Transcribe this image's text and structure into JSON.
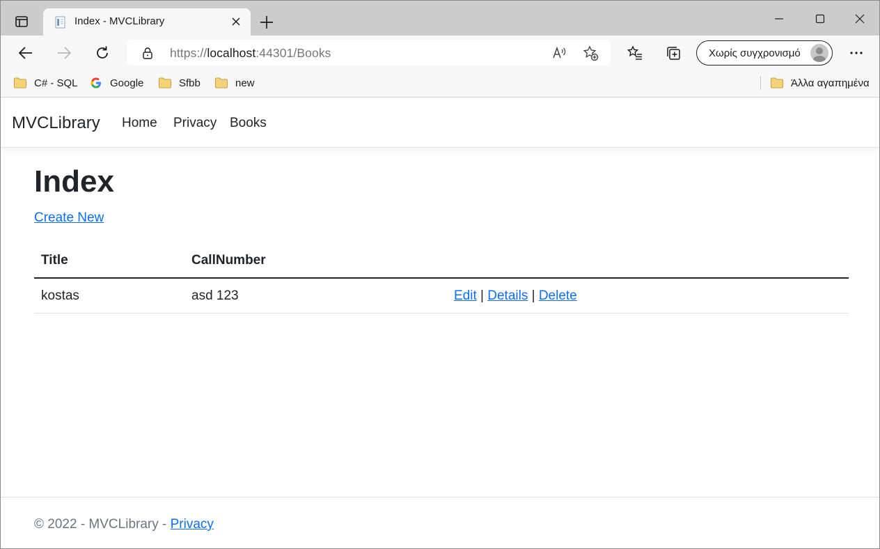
{
  "browser": {
    "tab_title": "Index - MVCLibrary",
    "url_prefix": "https://",
    "url_host": "localhost",
    "url_rest": ":44301/Books",
    "sync_label": "Χωρίς συγχρονισμό",
    "bookmarks": [
      {
        "label": "C# - SQL",
        "icon": "folder-icon"
      },
      {
        "label": "Google",
        "icon": "google-icon"
      },
      {
        "label": "Sfbb",
        "icon": "folder-icon"
      },
      {
        "label": "new",
        "icon": "folder-icon"
      }
    ],
    "other_favorites": "Άλλα αγαπημένα",
    "accent": "#0d6efd"
  },
  "navbar": {
    "brand": "MVCLibrary",
    "links": [
      "Home",
      "Privacy",
      "Books"
    ]
  },
  "main": {
    "title": "Index",
    "create_link": "Create New",
    "table": {
      "headers": [
        "Title",
        "CallNumber"
      ],
      "rows": [
        {
          "title": "kostas",
          "call_number": "asd 123",
          "edit": "Edit",
          "details": "Details",
          "delete": "Delete",
          "sep": "|"
        }
      ]
    }
  },
  "footer": {
    "text": "© 2022 - MVCLibrary - ",
    "link": "Privacy"
  }
}
